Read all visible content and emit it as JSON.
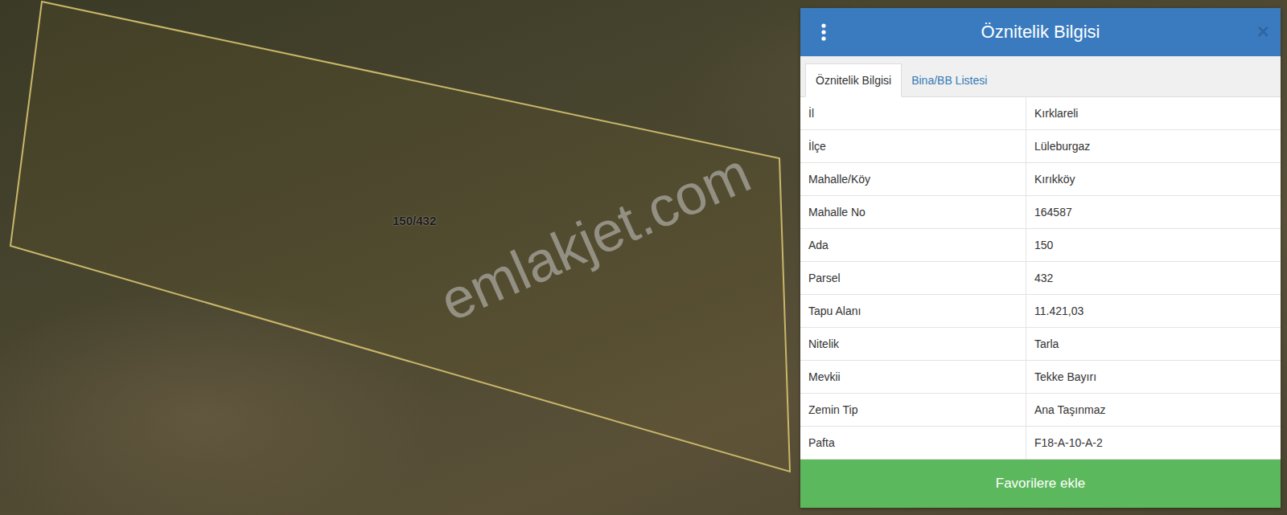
{
  "map": {
    "parcel_label": "150/432",
    "watermark": "emlakjet.com"
  },
  "panel": {
    "title": "Öznitelik Bilgisi",
    "close": "×",
    "tabs": [
      {
        "label": "Öznitelik Bilgisi",
        "selected": true
      },
      {
        "label": "Bina/BB Listesi",
        "selected": false
      }
    ],
    "rows": [
      {
        "label": "İl",
        "value": "Kırklareli"
      },
      {
        "label": "İlçe",
        "value": "Lüleburgaz"
      },
      {
        "label": "Mahalle/Köy",
        "value": "Kırıkköy"
      },
      {
        "label": "Mahalle No",
        "value": "164587"
      },
      {
        "label": "Ada",
        "value": "150"
      },
      {
        "label": "Parsel",
        "value": "432"
      },
      {
        "label": "Tapu Alanı",
        "value": "11.421,03"
      },
      {
        "label": "Nitelik",
        "value": "Tarla"
      },
      {
        "label": "Mevkii",
        "value": "Tekke Bayırı"
      },
      {
        "label": "Zemin Tip",
        "value": "Ana Taşınmaz"
      },
      {
        "label": "Pafta",
        "value": "F18-A-10-A-2"
      }
    ],
    "button": "Favorilere ekle"
  }
}
